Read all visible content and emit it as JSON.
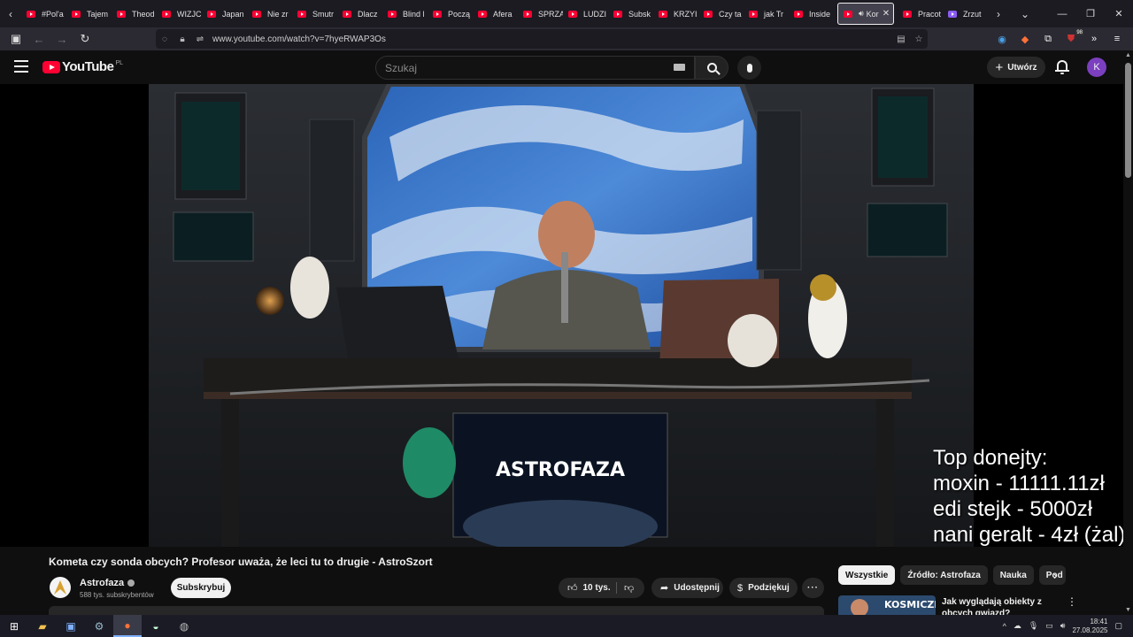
{
  "browser": {
    "tabs": [
      {
        "label": "#Pol'a"
      },
      {
        "label": "Tajem"
      },
      {
        "label": "Theod"
      },
      {
        "label": "WIZJC"
      },
      {
        "label": "Japan"
      },
      {
        "label": "Nie zr"
      },
      {
        "label": "Smutr"
      },
      {
        "label": "Dlacz"
      },
      {
        "label": "Blind l"
      },
      {
        "label": "Począ"
      },
      {
        "label": "Afera"
      },
      {
        "label": "SPRZA"
      },
      {
        "label": "LUDZI"
      },
      {
        "label": "Subsk"
      },
      {
        "label": "KRZYI"
      },
      {
        "label": "Czy ta"
      },
      {
        "label": "jak Tr"
      },
      {
        "label": "Inside"
      },
      {
        "label": "Kor",
        "active": true
      },
      {
        "label": "Pracot"
      },
      {
        "label": "Zrzut"
      }
    ],
    "url": "www.youtube.com/watch?v=7hyeRWAP3Os",
    "badge_count": "98"
  },
  "youtube": {
    "logo_text": "YouTube",
    "country_code": "PL",
    "search_placeholder": "Szukaj",
    "create_label": "Utwórz",
    "avatar_letter": "K"
  },
  "video": {
    "overlay_lines": [
      "Top donejty:",
      "moxin - 11111.11zł",
      "edi stejk - 5000zł",
      "nani geralt - 4zł (żal)"
    ],
    "set_brand": "ASTROFAZA",
    "title": "Kometa czy sonda obcych? Profesor uważa, że leci tu to drugie - AstroSzort",
    "channel_name": "Astrofaza",
    "subscribers": "588 tys. subskrybentów",
    "subscribe_label": "Subskrybuj",
    "likes": "10 tys.",
    "share_label": "Udostępnij",
    "thanks_label": "Podziękuj"
  },
  "sidebar": {
    "chips": [
      {
        "label": "Wszystkie",
        "active": true
      },
      {
        "label": "Źródło: Astrofaza"
      },
      {
        "label": "Nauka"
      },
      {
        "label": "Pod"
      }
    ],
    "suggestion": {
      "thumb_text": "KOSMICZNI",
      "title": "Jak wyglądają obiekty z obcych gwiazd?"
    }
  },
  "taskbar": {
    "time": "18:41",
    "date": "27.08.2025"
  }
}
